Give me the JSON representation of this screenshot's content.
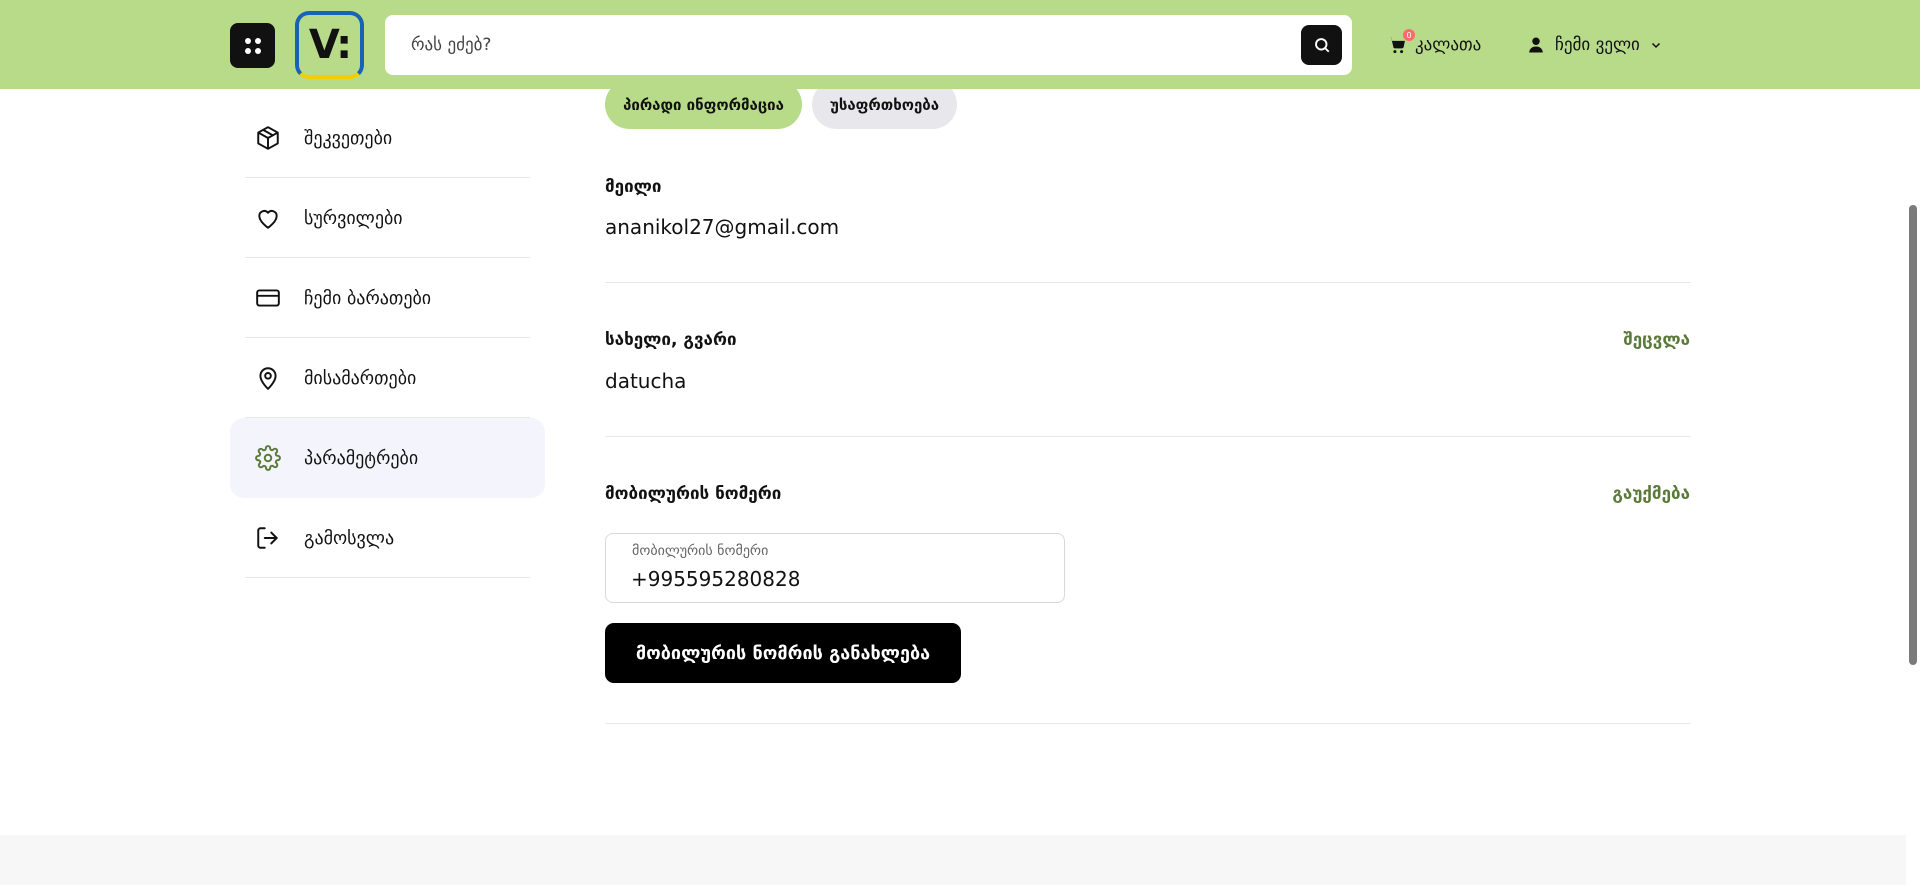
{
  "header": {
    "logo_text": "V:",
    "search_placeholder": "რას ეძებ?",
    "cart_label": "კალათა",
    "cart_count": "0",
    "account_label": "ჩემი ველი"
  },
  "sidebar": {
    "items": [
      {
        "label": "შეკვეთები",
        "icon": "package-icon"
      },
      {
        "label": "სურვილები",
        "icon": "heart-icon"
      },
      {
        "label": "ჩემი ბარათები",
        "icon": "credit-card-icon"
      },
      {
        "label": "მისამართები",
        "icon": "map-pin-icon"
      },
      {
        "label": "პარამეტრები",
        "icon": "gear-icon",
        "active": true
      },
      {
        "label": "გამოსვლა",
        "icon": "logout-icon"
      }
    ]
  },
  "tabs": {
    "personal": "პირადი ინფორმაცია",
    "security": "უსაფრთხოება"
  },
  "profile": {
    "email_label": "მეილი",
    "email_value": "ananikol27@gmail.com",
    "name_label": "სახელი, გვარი",
    "name_value": "datucha",
    "name_action": "შეცვლა",
    "phone_label": "მობილურის ნომერი",
    "phone_action": "გაუქმება",
    "phone_field_label": "მობილურის ნომერი",
    "phone_value": "+995595280828",
    "update_button": "მობილურის ნომრის განახლება"
  },
  "colors": {
    "header_bg": "#b7db88",
    "accent_text": "#5b7a3a",
    "active_sidebar_bg": "#f4f4fc"
  }
}
